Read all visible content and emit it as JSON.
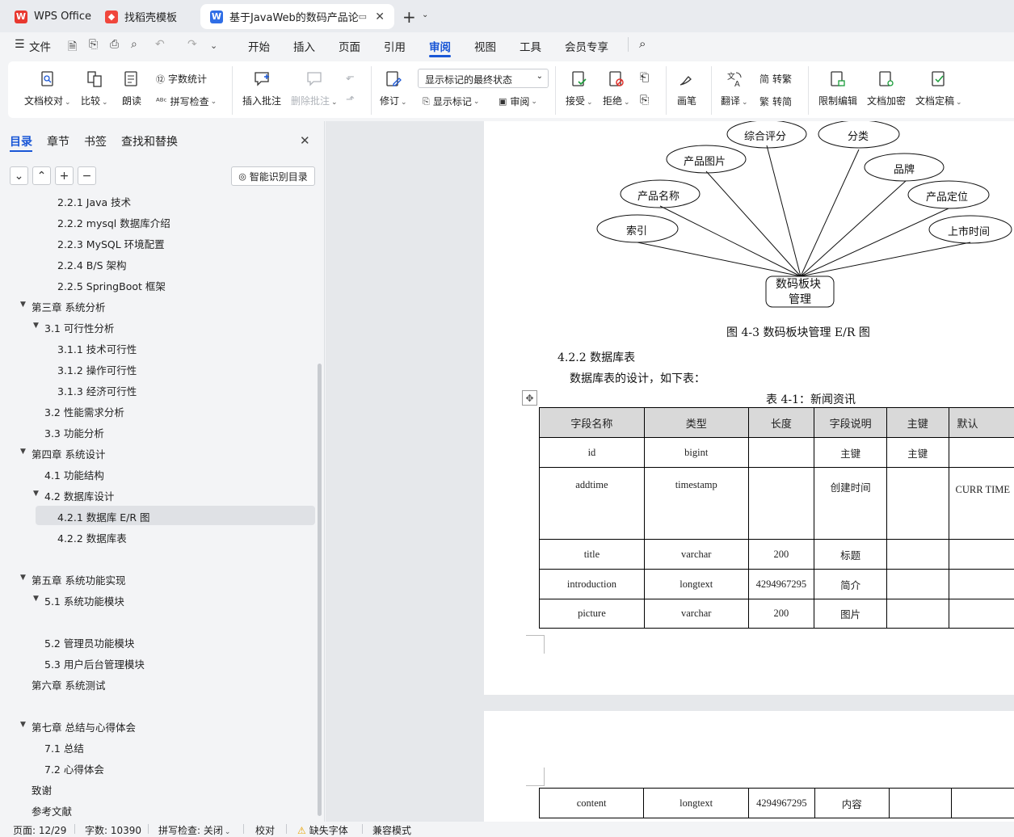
{
  "titlebar": {
    "tabs": [
      {
        "label": "WPS Office",
        "icon": "wps-logo-icon"
      },
      {
        "label": "找稻壳模板",
        "icon": "docer-icon"
      },
      {
        "label": "基于JavaWeb的数码产品论坛",
        "icon": "writer-doc-icon"
      }
    ],
    "new_tab": "+"
  },
  "menubar": {
    "file": "文件",
    "items": [
      "开始",
      "插入",
      "页面",
      "引用",
      "审阅",
      "视图",
      "工具",
      "会员专享"
    ],
    "active": "审阅"
  },
  "ribbon": {
    "doc_check": "文档校对",
    "compare": "比较",
    "read_aloud": "朗读",
    "word_count": "字数统计",
    "spell_check": "拼写检查",
    "insert_comment": "插入批注",
    "delete_comment": "删除批注",
    "track_changes": "修订",
    "markup_state": "显示标记的最终状态",
    "show_markup": "显示标记",
    "review": "审阅",
    "accept": "接受",
    "reject": "拒绝",
    "pen": "画笔",
    "translate": "翻译",
    "to_traditional": "转繁",
    "to_simplified": "转简",
    "restrict_edit": "限制编辑",
    "encrypt": "文档加密",
    "finalize": "文档定稿",
    "small_trad": "简",
    "small_simp": "繁"
  },
  "nav": {
    "tabs": [
      "目录",
      "章节",
      "书签",
      "查找和替换"
    ],
    "smart_button": "智能识别目录",
    "toc": [
      "2.2.1 Java 技术",
      "2.2.2 mysql 数据库介绍",
      "2.2.3 MySQL 环境配置",
      "2.2.4 B/S 架构",
      "2.2.5 SpringBoot 框架",
      "第三章  系统分析",
      "3.1  可行性分析",
      "3.1.1 技术可行性",
      "3.1.2 操作可行性",
      "3.1.3  经济可行性",
      "3.2 性能需求分析",
      "3.3 功能分析",
      "第四章  系统设计",
      "4.1 功能结构",
      "4.2  数据库设计",
      "4.2.1  数据库 E/R 图",
      "4.2.2  数据库表",
      "第五章  系统功能实现",
      "5.1 系统功能模块",
      "5.2  管理员功能模块",
      "5.3  用户后台管理模块",
      "第六章  系统测试",
      "第七章  总结与心得体会",
      "7.1  总结",
      "7.2  心得体会",
      "致谢",
      "参考文献"
    ]
  },
  "doc": {
    "er_nodes": [
      "综合评分",
      "分类",
      "产品图片",
      "品牌",
      "产品名称",
      "产品定位",
      "索引",
      "上市时间"
    ],
    "er_center": [
      "数码板块",
      "管理"
    ],
    "figure_caption": "图 4-3 数码板块管理 E/R 图",
    "section_heading": "4.2.2  数据库表",
    "intro": "数据库表的设计，如下表：",
    "table_caption": "表 4-1：新闻资讯",
    "table_headers": [
      "字段名称",
      "类型",
      "长度",
      "字段说明",
      "主键",
      "默认"
    ],
    "table_rows": [
      [
        "id",
        "bigint",
        "",
        "主键",
        "主键",
        ""
      ],
      [
        "addtime",
        "timestamp",
        "",
        "创建时间",
        "",
        "CURR TIME"
      ],
      [
        "title",
        "varchar",
        "200",
        "标题",
        "",
        ""
      ],
      [
        "introduction",
        "longtext",
        "4294967295",
        "简介",
        "",
        ""
      ],
      [
        "picture",
        "varchar",
        "200",
        "图片",
        "",
        ""
      ]
    ],
    "page2_row": [
      "content",
      "longtext",
      "4294967295",
      "内容",
      "",
      ""
    ]
  },
  "status": {
    "page": "页面: 12/29",
    "words": "字数: 10390",
    "spell": "拼写检查: 关闭",
    "proof": "校对",
    "missing_font": "缺失字体",
    "compat": "兼容模式"
  }
}
